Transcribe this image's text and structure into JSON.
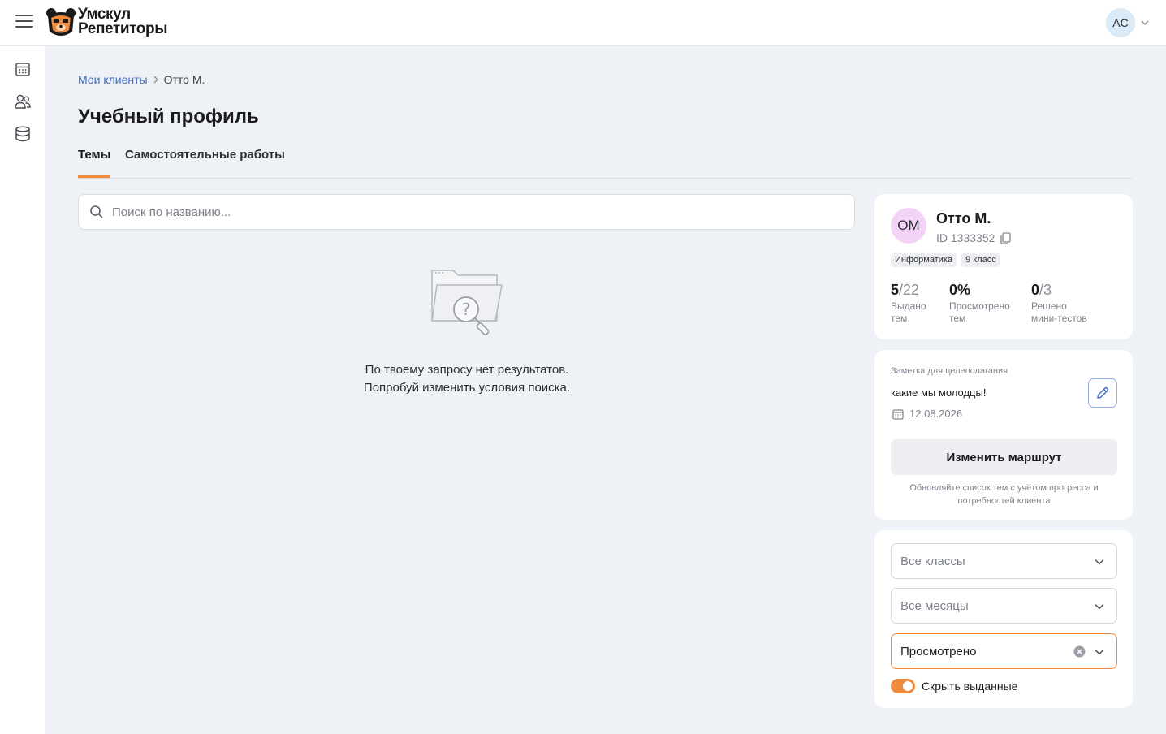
{
  "header": {
    "logo_line1": "Умскул",
    "logo_line2": "Репетиторы",
    "user_initials": "AC"
  },
  "sidebar": {
    "items": [
      {
        "icon": "calendar-icon"
      },
      {
        "icon": "users-icon"
      },
      {
        "icon": "database-icon"
      }
    ]
  },
  "breadcrumb": {
    "parent": "Мои клиенты",
    "current": "Отто М."
  },
  "page_title": "Учебный профиль",
  "tabs": [
    {
      "label": "Темы",
      "active": true
    },
    {
      "label": "Самостоятельные работы",
      "active": false
    }
  ],
  "search": {
    "placeholder": "Поиск по названию..."
  },
  "empty_state": {
    "line1": "По твоему запросу нет результатов.",
    "line2": "Попробуй изменить условия поиска."
  },
  "client": {
    "initials": "ОМ",
    "name": "Отто М.",
    "id_text": "ID 1333352",
    "tags": [
      "Информатика",
      "9 класс"
    ],
    "stats": [
      {
        "value": "5",
        "total": "/22",
        "label1": "Выдано",
        "label2": "тем"
      },
      {
        "value": "0%",
        "total": "",
        "label1": "Просмотрено",
        "label2": "тем"
      },
      {
        "value": "0",
        "total": "/3",
        "label1": "Решено",
        "label2": "мини-тестов"
      }
    ]
  },
  "note": {
    "label": "Заметка для целеполагания",
    "text": "какие мы молодцы!",
    "date": "12.08.2026",
    "route_button": "Изменить маршрут",
    "hint": "Обновляйте список тем с учётом прогресса и потребностей клиента"
  },
  "filters": {
    "classes": "Все классы",
    "months": "Все месяцы",
    "status": "Просмотрено",
    "toggle_label": "Скрыть выданные",
    "toggle_on": true
  },
  "colors": {
    "accent": "#f08a3c",
    "link": "#3d6cc2",
    "background": "#eef1f6"
  }
}
